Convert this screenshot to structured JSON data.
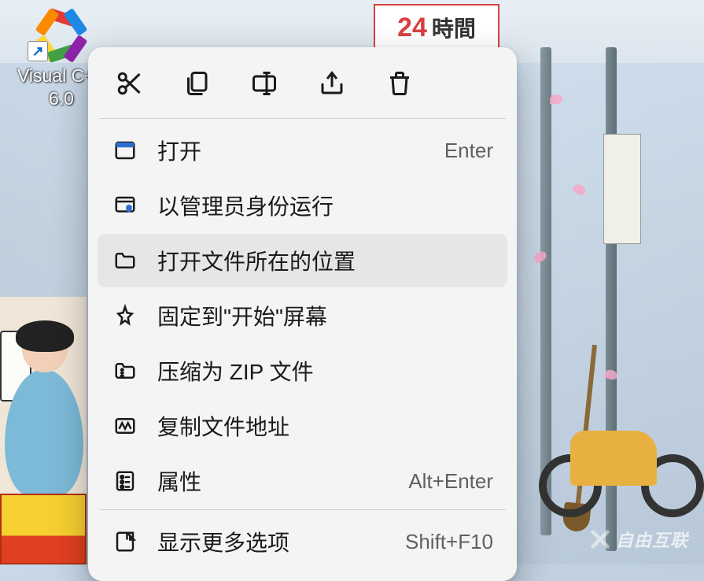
{
  "desktop_icon": {
    "label_line1": "Visual C++",
    "label_line2": "6.0"
  },
  "signboard": {
    "hours_text": "時間"
  },
  "watermark": {
    "text": "自由互联"
  },
  "context_menu": {
    "toolbar": {
      "cut": "cut",
      "copy": "copy",
      "rename": "rename",
      "share": "share",
      "delete": "delete"
    },
    "items": [
      {
        "id": "open",
        "label": "打开",
        "accel": "Enter"
      },
      {
        "id": "run-admin",
        "label": "以管理员身份运行",
        "accel": ""
      },
      {
        "id": "open-location",
        "label": "打开文件所在的位置",
        "accel": ""
      },
      {
        "id": "pin-start",
        "label": "固定到\"开始\"屏幕",
        "accel": ""
      },
      {
        "id": "compress-zip",
        "label": "压缩为 ZIP 文件",
        "accel": ""
      },
      {
        "id": "copy-path",
        "label": "复制文件地址",
        "accel": ""
      },
      {
        "id": "properties",
        "label": "属性",
        "accel": "Alt+Enter"
      },
      {
        "id": "show-more",
        "label": "显示更多选项",
        "accel": "Shift+F10"
      }
    ]
  }
}
